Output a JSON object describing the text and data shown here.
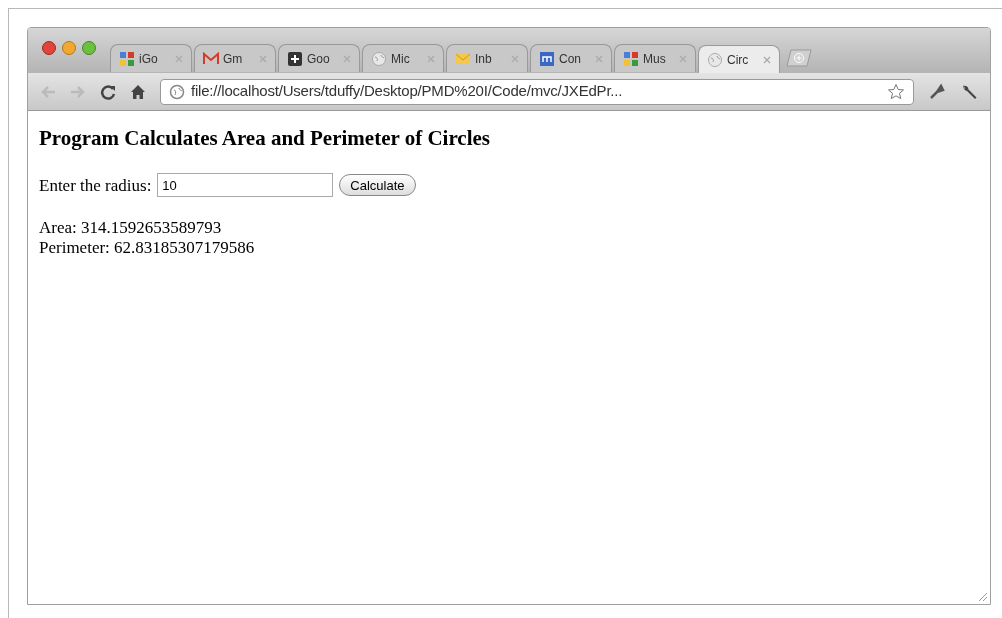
{
  "tabs": [
    {
      "label": "iGo",
      "kind": "blocks",
      "selected": false
    },
    {
      "label": "Gm",
      "kind": "mail",
      "selected": false
    },
    {
      "label": "Goo",
      "kind": "plus",
      "selected": false
    },
    {
      "label": "Mic",
      "kind": "globe",
      "selected": false
    },
    {
      "label": "Inb",
      "kind": "envelope",
      "selected": false
    },
    {
      "label": "Con",
      "kind": "square",
      "selected": false
    },
    {
      "label": "Mus",
      "kind": "blocks",
      "selected": false
    },
    {
      "label": "Circ",
      "kind": "globe",
      "selected": true
    }
  ],
  "address": "file://localhost/Users/tduffy/Desktop/PMD%20I/Code/mvc/JXEdPr...",
  "page": {
    "heading": "Program Calculates Area and Perimeter of Circles",
    "field_label": "Enter the radius:",
    "field_value": "10",
    "button": "Calculate",
    "results": [
      "Area: 314.1592653589793",
      "Perimeter: 62.83185307179586"
    ]
  }
}
